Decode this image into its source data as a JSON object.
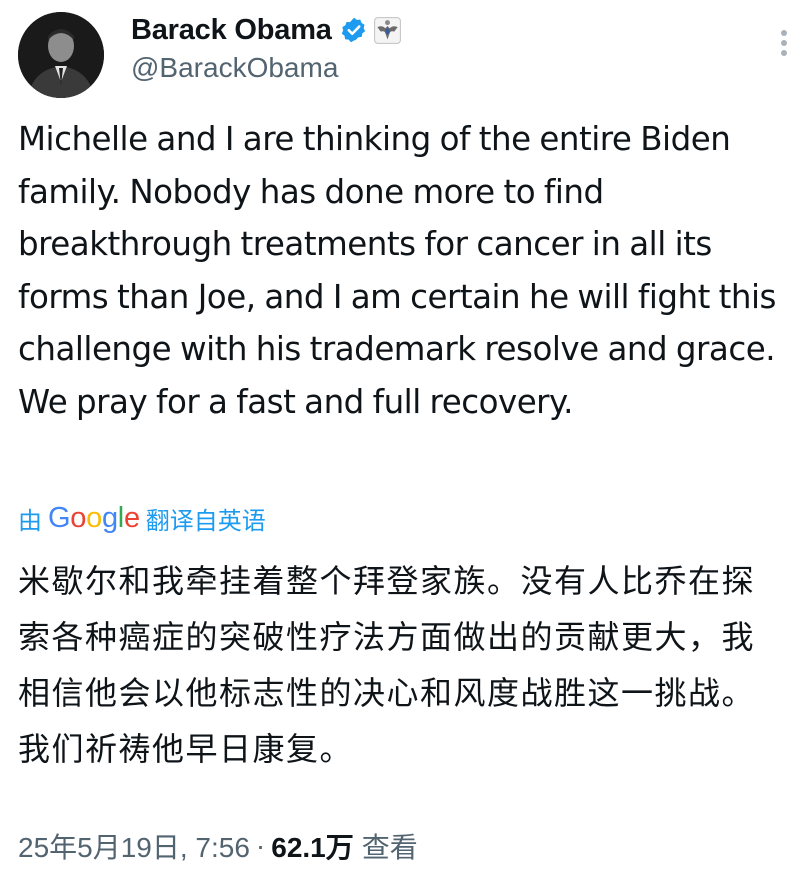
{
  "author": {
    "display_name": "Barack Obama",
    "handle": "@BarackObama",
    "avatar_icon": "avatar-photo",
    "verified_icon": "verified-badge-icon",
    "affiliation_icon": "us-government-seal-icon",
    "verified_color": "#1d9bf0"
  },
  "tweet": {
    "text": "Michelle and I are thinking of the entire Biden family. Nobody has done more to find breakthrough treatments for cancer in all its forms than Joe, and I am certain he will fight this challenge with his trademark resolve and grace. We pray for a fast and full recovery."
  },
  "translation": {
    "prefix": "由",
    "provider": "Google",
    "suffix": "翻译自英语",
    "text": "米歇尔和我牵挂着整个拜登家族。没有人比乔在探索各种癌症的突破性疗法方面做出的贡献更大，我相信他会以他标志性的决心和风度战胜这一挑战。我们祈祷他早日康复。"
  },
  "meta": {
    "timestamp": "25年5月19日, 7:56",
    "separator": "·",
    "views_count": "62.1万",
    "views_label": "查看"
  },
  "colors": {
    "text": "#0f1419",
    "secondary": "#536471",
    "accent": "#1d9bf0"
  }
}
